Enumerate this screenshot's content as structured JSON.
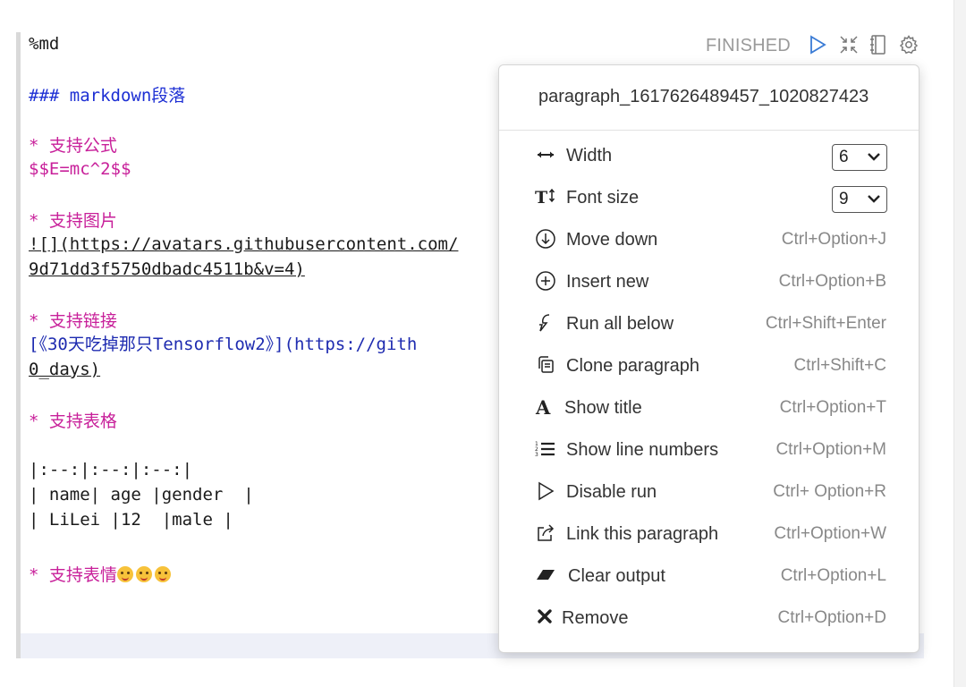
{
  "editor": {
    "lines": [
      "%md",
      "### markdown段落",
      "* 支持公式",
      "$$E=mc^2$$",
      "* 支持图片",
      "![](https://avatars.githubusercontent.com/",
      "9d71dd3f5750dbadc4511b&v=4)",
      "* 支持链接",
      "[《30天吃掉那只Tensorflow2》](https://gith",
      "0_days)",
      "* 支持表格",
      "|:--:|:--:|:--:|",
      "| name| age |gender  |",
      "| LiLei |12  |male |",
      "* 支持表情"
    ]
  },
  "toolbar": {
    "status": "FINISHED",
    "icons": [
      "run-icon",
      "collapse-icon",
      "notebook-icon",
      "gear-icon"
    ]
  },
  "menu": {
    "title": "paragraph_1617626489457_1020827423",
    "items": [
      {
        "label": "Width",
        "icon": "width-arrows-icon",
        "select_value": "6"
      },
      {
        "label": "Font size",
        "icon": "font-size-icon",
        "select_value": "9"
      },
      {
        "label": "Move down",
        "icon": "move-down-icon",
        "shortcut": "Ctrl+Option+J"
      },
      {
        "label": "Insert new",
        "icon": "insert-new-icon",
        "shortcut": "Ctrl+Option+B"
      },
      {
        "label": "Run all below",
        "icon": "run-all-below-icon",
        "shortcut": "Ctrl+Shift+Enter"
      },
      {
        "label": "Clone paragraph",
        "icon": "clone-icon",
        "shortcut": "Ctrl+Shift+C"
      },
      {
        "label": "Show title",
        "icon": "title-icon",
        "shortcut": "Ctrl+Option+T"
      },
      {
        "label": "Show line numbers",
        "icon": "line-numbers-icon",
        "shortcut": "Ctrl+Option+M"
      },
      {
        "label": "Disable run",
        "icon": "disable-run-icon",
        "shortcut": "Ctrl+ Option+R"
      },
      {
        "label": "Link this paragraph",
        "icon": "link-icon",
        "shortcut": "Ctrl+Option+W"
      },
      {
        "label": "Clear output",
        "icon": "eraser-icon",
        "shortcut": "Ctrl+Option+L"
      },
      {
        "label": "Remove",
        "icon": "remove-icon",
        "shortcut": "Ctrl+Option+D"
      }
    ]
  }
}
